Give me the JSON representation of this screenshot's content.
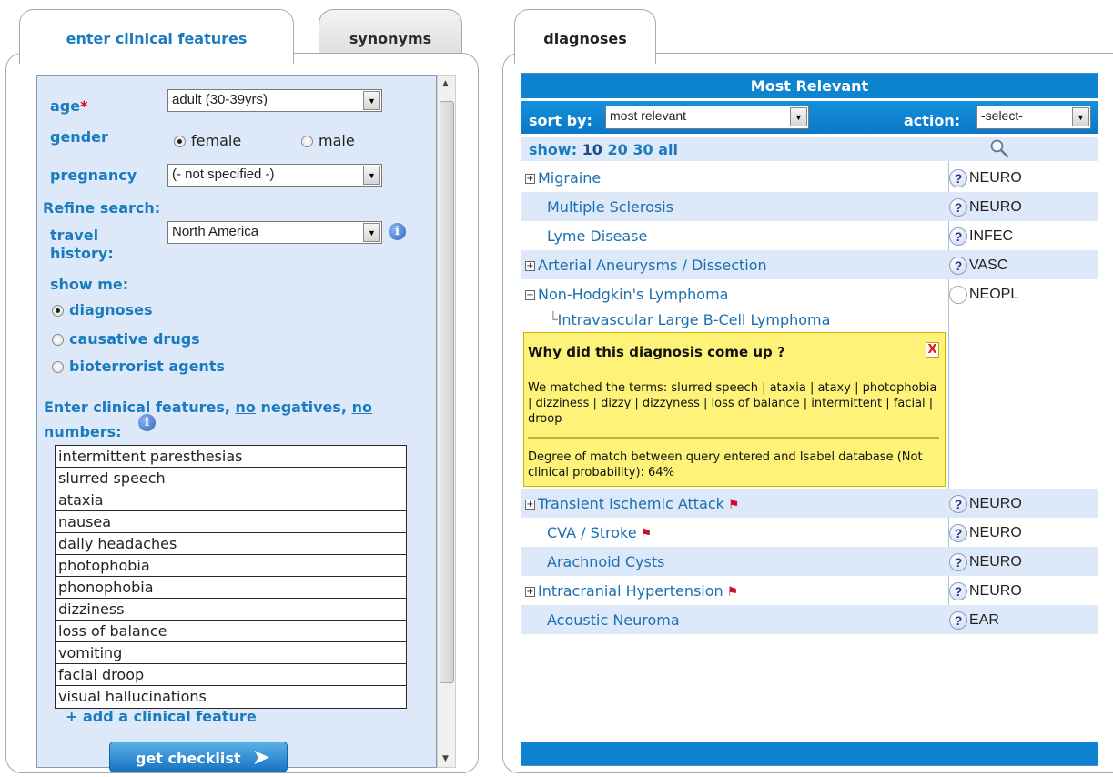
{
  "tabs": {
    "enter": "enter clinical features",
    "synonyms": "synonyms",
    "diagnoses": "diagnoses"
  },
  "form": {
    "age_label": "age",
    "age_required": "*",
    "age_value": "adult (30-39yrs)",
    "gender_label": "gender",
    "gender_female": "female",
    "gender_male": "male",
    "gender_selected": "female",
    "pregnancy_label": "pregnancy",
    "pregnancy_value": "(- not specified -)",
    "refine_label": "Refine search:",
    "travel_label": "travel history:",
    "travel_value": "North America",
    "show_me_label": "show me:",
    "show_options": [
      "diagnoses",
      "causative drugs",
      "bioterrorist agents"
    ],
    "show_selected": "diagnoses",
    "features_prefix": "Enter clinical features, ",
    "features_no1": "no",
    "features_mid": " negatives, ",
    "features_no2": "no",
    "features_suffix": " numbers:",
    "features": [
      "intermittent paresthesias",
      "slurred speech",
      "ataxia",
      "nausea",
      "daily headaches",
      "photophobia",
      "phonophobia",
      "dizziness",
      "loss of balance",
      "vomiting",
      "facial droop",
      "visual hallucinations"
    ],
    "add_feature": "+ add a clinical feature",
    "get_checklist": "get checklist"
  },
  "results": {
    "header": "Most Relevant",
    "sort_label": "sort by:",
    "sort_value": "most relevant",
    "action_label": "action:",
    "action_value": "-select-",
    "show_label": "show:",
    "show_options": [
      "10",
      "20",
      "30",
      "all"
    ],
    "diagnoses": [
      {
        "name": "Migraine",
        "specialty": "NEURO",
        "expandable": true,
        "flag": false
      },
      {
        "name": "Multiple Sclerosis",
        "specialty": "NEURO",
        "expandable": false,
        "flag": false
      },
      {
        "name": "Lyme Disease",
        "specialty": "INFEC",
        "expandable": false,
        "flag": false
      },
      {
        "name": "Arterial Aneurysms / Dissection",
        "specialty": "VASC",
        "expandable": true,
        "flag": false
      },
      {
        "name": "Non-Hodgkin's Lymphoma",
        "specialty": "NEOPL",
        "expandable": true,
        "expanded": true,
        "flag": false
      },
      {
        "name": "Transient Ischemic Attack",
        "specialty": "NEURO",
        "expandable": true,
        "flag": true
      },
      {
        "name": "CVA / Stroke",
        "specialty": "NEURO",
        "expandable": false,
        "flag": true
      },
      {
        "name": "Arachnoid Cysts",
        "specialty": "NEURO",
        "expandable": false,
        "flag": false
      },
      {
        "name": "Intracranial Hypertension",
        "specialty": "NEURO",
        "expandable": true,
        "flag": true
      },
      {
        "name": "Acoustic Neuroma",
        "specialty": "EAR",
        "expandable": false,
        "flag": false
      }
    ],
    "sub_diagnosis": "Intravascular Large B-Cell Lymphoma",
    "why": {
      "title": "Why did this diagnosis come up ?",
      "close": "X",
      "terms": "We matched the terms: slurred speech | ataxia | ataxy | photophobia | dizziness | dizzy | dizzyness | loss of balance | intermittent | facial | droop",
      "degree": "Degree of match between query entered and Isabel database (Not clinical probability): 64%"
    }
  },
  "colors": {
    "accent_blue": "#1a7bbf",
    "header_blue": "#0e83cf",
    "panel_fill": "#dde9f8",
    "tooltip_yellow": "#fff278",
    "flag_red": "#c8102e"
  },
  "icons": {
    "info": "info-icon",
    "help": "question-icon",
    "flag": "red-flag-icon",
    "search": "magnifier-icon",
    "expand": "plus-box-icon",
    "collapse": "minus-box-icon"
  }
}
